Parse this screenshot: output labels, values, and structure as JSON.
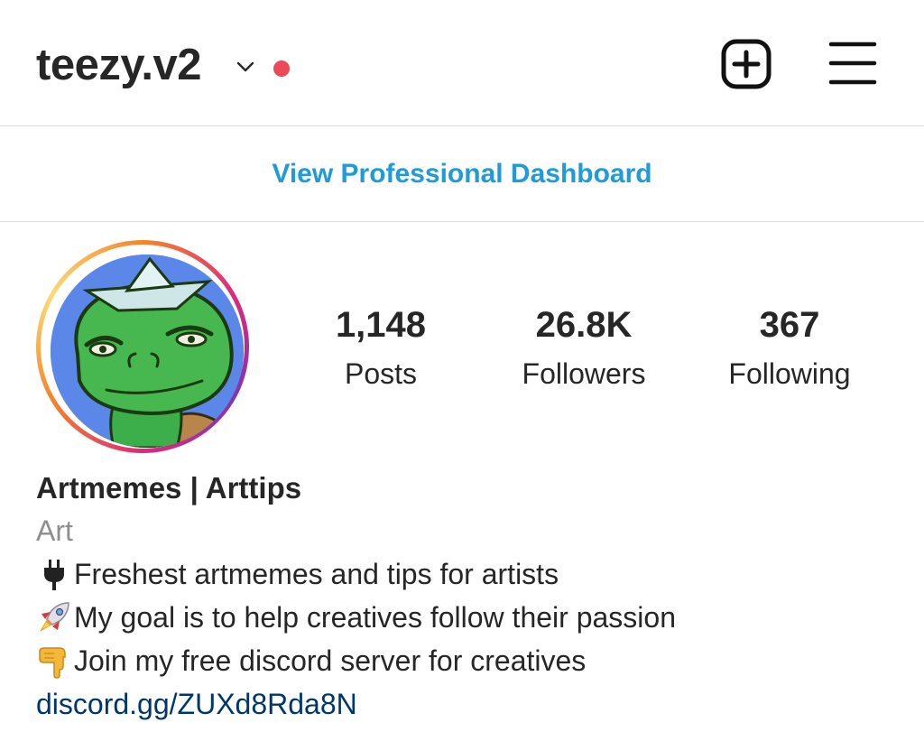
{
  "header": {
    "username": "teezy.v2",
    "notification_dot_color": "#ed4956",
    "icons": [
      "chevron-down-icon",
      "new-post-icon",
      "hamburger-menu-icon"
    ]
  },
  "dashboard": {
    "label": "View Professional Dashboard",
    "color": "#1f9bd7"
  },
  "stats": [
    {
      "value": "1,148",
      "label": "Posts"
    },
    {
      "value": "26.8K",
      "label": "Followers"
    },
    {
      "value": "367",
      "label": "Following"
    }
  ],
  "bio": {
    "name": "Artmemes | Arttips",
    "category": "Art",
    "lines": [
      {
        "icon": "plug-icon",
        "text": "Freshest artmemes and tips for artists"
      },
      {
        "icon": "rocket-icon",
        "text": "My goal is to help creatives follow their passion"
      },
      {
        "icon": "pointing-down-icon",
        "text": "Join my free discord server for creatives"
      }
    ],
    "link": "discord.gg/ZUXd8Rda8N"
  }
}
